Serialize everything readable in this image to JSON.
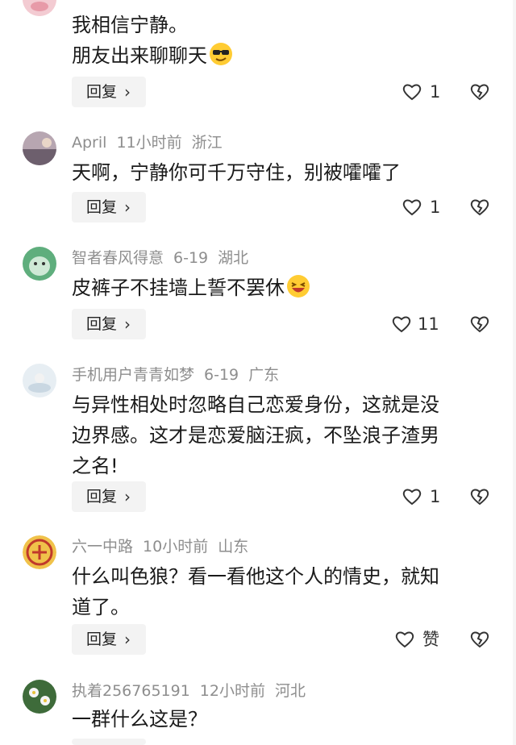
{
  "comments": [
    {
      "meta_user": "",
      "meta_time": "",
      "meta_location": "",
      "lines": [
        "我相信宁静。",
        "朋友出来聊聊天"
      ],
      "reply_label": "回复",
      "like_count": "1"
    },
    {
      "meta_user": "April",
      "meta_time": "11小时前",
      "meta_location": "浙江",
      "lines": [
        "天啊，宁静你可千万守住，别被嚯嚯了"
      ],
      "reply_label": "回复",
      "like_count": "1"
    },
    {
      "meta_user": "智者春风得意",
      "meta_time": "6-19",
      "meta_location": "湖北",
      "lines": [
        "皮裤子不挂墙上誓不罢休"
      ],
      "reply_label": "回复",
      "like_count": "11"
    },
    {
      "meta_user": "手机用户青青如梦",
      "meta_time": "6-19",
      "meta_location": "广东",
      "lines": [
        "与异性相处时忽略自己恋爱身份，这就是没",
        "边界感。这才是恋爱脑汪疯，不坠浪子渣男",
        "之名!"
      ],
      "reply_label": "回复",
      "like_count": "1"
    },
    {
      "meta_user": "六一中路",
      "meta_time": "10小时前",
      "meta_location": "山东",
      "lines": [
        "什么叫色狼？看一看他这个人的情史，就知",
        "道了。"
      ],
      "reply_label": "回复",
      "like_count": "赞"
    },
    {
      "meta_user": "执着256765191",
      "meta_time": "12小时前",
      "meta_location": "河北",
      "lines": [
        "一群什么这是？"
      ]
    }
  ],
  "icons": {
    "like": "heart-outline-icon",
    "dislike": "broken-heart-icon",
    "chevron": "chevron-right-icon"
  },
  "colors": {
    "meta": "#8e8e8e",
    "text": "#1a1a1a",
    "reply_bg": "#f3f3f3"
  }
}
